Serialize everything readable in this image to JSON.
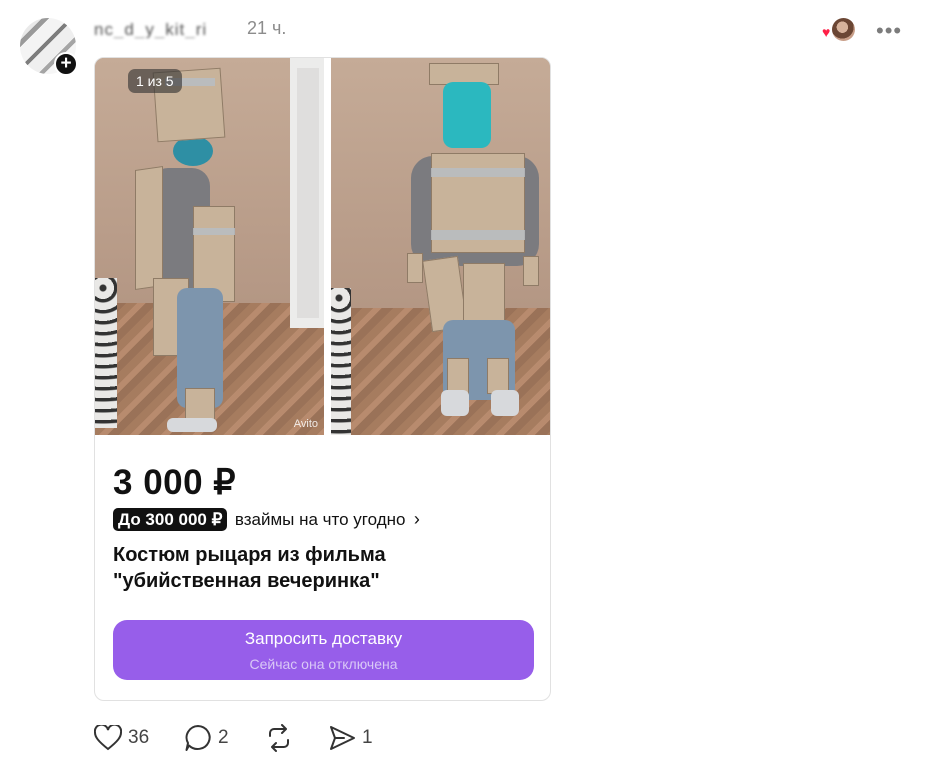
{
  "post": {
    "username": "nc_d_y_kit_ri",
    "time": "21 ч.",
    "more_label": "•••",
    "add_symbol": "+"
  },
  "listing": {
    "counter": "1 из 5",
    "watermark": "Avito",
    "price": "3 000 ₽",
    "loan_badge": "До 300 000 ₽",
    "loan_text": "взаймы на что угодно",
    "loan_arrow": "›",
    "title": "Костюм рыцаря из фильма\n\"убийственная вечеринка\"",
    "cta_label": "Запросить доставку",
    "cta_sublabel": "Сейчас она отключена",
    "accent_color": "#975eea"
  },
  "actions": {
    "likes": "36",
    "replies": "2",
    "reposts": "",
    "shares": "1"
  },
  "icons": {
    "like": "heart-icon",
    "reply": "speech-bubble-icon",
    "repost": "repost-icon",
    "share": "send-icon",
    "liked_by": "heart-icon"
  }
}
